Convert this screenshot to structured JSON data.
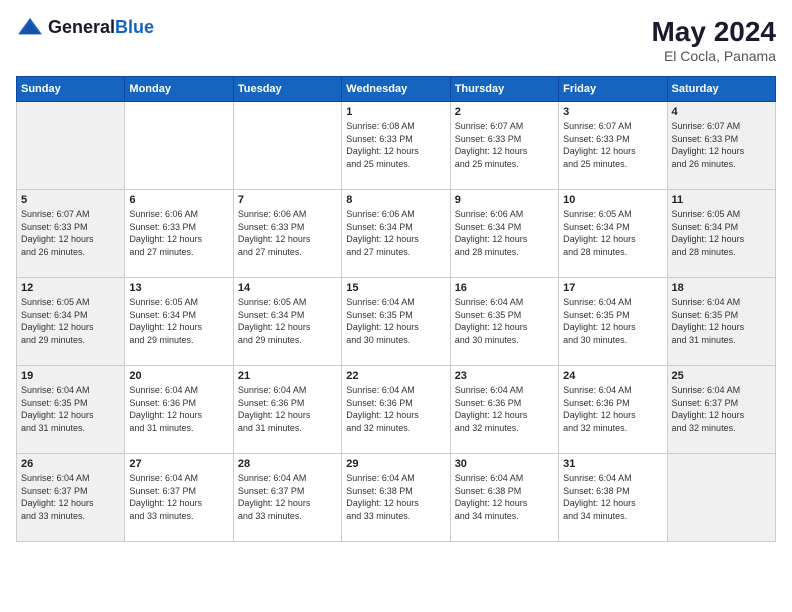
{
  "logo": {
    "general": "General",
    "blue": "Blue"
  },
  "title": {
    "month_year": "May 2024",
    "location": "El Cocla, Panama"
  },
  "headers": [
    "Sunday",
    "Monday",
    "Tuesday",
    "Wednesday",
    "Thursday",
    "Friday",
    "Saturday"
  ],
  "weeks": [
    {
      "days": [
        {
          "num": "",
          "text": "",
          "weekend": true
        },
        {
          "num": "",
          "text": "",
          "weekend": false
        },
        {
          "num": "",
          "text": "",
          "weekend": false
        },
        {
          "num": "1",
          "text": "Sunrise: 6:08 AM\nSunset: 6:33 PM\nDaylight: 12 hours\nand 25 minutes.",
          "weekend": false
        },
        {
          "num": "2",
          "text": "Sunrise: 6:07 AM\nSunset: 6:33 PM\nDaylight: 12 hours\nand 25 minutes.",
          "weekend": false
        },
        {
          "num": "3",
          "text": "Sunrise: 6:07 AM\nSunset: 6:33 PM\nDaylight: 12 hours\nand 25 minutes.",
          "weekend": false
        },
        {
          "num": "4",
          "text": "Sunrise: 6:07 AM\nSunset: 6:33 PM\nDaylight: 12 hours\nand 26 minutes.",
          "weekend": true
        }
      ]
    },
    {
      "days": [
        {
          "num": "5",
          "text": "Sunrise: 6:07 AM\nSunset: 6:33 PM\nDaylight: 12 hours\nand 26 minutes.",
          "weekend": true
        },
        {
          "num": "6",
          "text": "Sunrise: 6:06 AM\nSunset: 6:33 PM\nDaylight: 12 hours\nand 27 minutes.",
          "weekend": false
        },
        {
          "num": "7",
          "text": "Sunrise: 6:06 AM\nSunset: 6:33 PM\nDaylight: 12 hours\nand 27 minutes.",
          "weekend": false
        },
        {
          "num": "8",
          "text": "Sunrise: 6:06 AM\nSunset: 6:34 PM\nDaylight: 12 hours\nand 27 minutes.",
          "weekend": false
        },
        {
          "num": "9",
          "text": "Sunrise: 6:06 AM\nSunset: 6:34 PM\nDaylight: 12 hours\nand 28 minutes.",
          "weekend": false
        },
        {
          "num": "10",
          "text": "Sunrise: 6:05 AM\nSunset: 6:34 PM\nDaylight: 12 hours\nand 28 minutes.",
          "weekend": false
        },
        {
          "num": "11",
          "text": "Sunrise: 6:05 AM\nSunset: 6:34 PM\nDaylight: 12 hours\nand 28 minutes.",
          "weekend": true
        }
      ]
    },
    {
      "days": [
        {
          "num": "12",
          "text": "Sunrise: 6:05 AM\nSunset: 6:34 PM\nDaylight: 12 hours\nand 29 minutes.",
          "weekend": true
        },
        {
          "num": "13",
          "text": "Sunrise: 6:05 AM\nSunset: 6:34 PM\nDaylight: 12 hours\nand 29 minutes.",
          "weekend": false
        },
        {
          "num": "14",
          "text": "Sunrise: 6:05 AM\nSunset: 6:34 PM\nDaylight: 12 hours\nand 29 minutes.",
          "weekend": false
        },
        {
          "num": "15",
          "text": "Sunrise: 6:04 AM\nSunset: 6:35 PM\nDaylight: 12 hours\nand 30 minutes.",
          "weekend": false
        },
        {
          "num": "16",
          "text": "Sunrise: 6:04 AM\nSunset: 6:35 PM\nDaylight: 12 hours\nand 30 minutes.",
          "weekend": false
        },
        {
          "num": "17",
          "text": "Sunrise: 6:04 AM\nSunset: 6:35 PM\nDaylight: 12 hours\nand 30 minutes.",
          "weekend": false
        },
        {
          "num": "18",
          "text": "Sunrise: 6:04 AM\nSunset: 6:35 PM\nDaylight: 12 hours\nand 31 minutes.",
          "weekend": true
        }
      ]
    },
    {
      "days": [
        {
          "num": "19",
          "text": "Sunrise: 6:04 AM\nSunset: 6:35 PM\nDaylight: 12 hours\nand 31 minutes.",
          "weekend": true
        },
        {
          "num": "20",
          "text": "Sunrise: 6:04 AM\nSunset: 6:36 PM\nDaylight: 12 hours\nand 31 minutes.",
          "weekend": false
        },
        {
          "num": "21",
          "text": "Sunrise: 6:04 AM\nSunset: 6:36 PM\nDaylight: 12 hours\nand 31 minutes.",
          "weekend": false
        },
        {
          "num": "22",
          "text": "Sunrise: 6:04 AM\nSunset: 6:36 PM\nDaylight: 12 hours\nand 32 minutes.",
          "weekend": false
        },
        {
          "num": "23",
          "text": "Sunrise: 6:04 AM\nSunset: 6:36 PM\nDaylight: 12 hours\nand 32 minutes.",
          "weekend": false
        },
        {
          "num": "24",
          "text": "Sunrise: 6:04 AM\nSunset: 6:36 PM\nDaylight: 12 hours\nand 32 minutes.",
          "weekend": false
        },
        {
          "num": "25",
          "text": "Sunrise: 6:04 AM\nSunset: 6:37 PM\nDaylight: 12 hours\nand 32 minutes.",
          "weekend": true
        }
      ]
    },
    {
      "days": [
        {
          "num": "26",
          "text": "Sunrise: 6:04 AM\nSunset: 6:37 PM\nDaylight: 12 hours\nand 33 minutes.",
          "weekend": true
        },
        {
          "num": "27",
          "text": "Sunrise: 6:04 AM\nSunset: 6:37 PM\nDaylight: 12 hours\nand 33 minutes.",
          "weekend": false
        },
        {
          "num": "28",
          "text": "Sunrise: 6:04 AM\nSunset: 6:37 PM\nDaylight: 12 hours\nand 33 minutes.",
          "weekend": false
        },
        {
          "num": "29",
          "text": "Sunrise: 6:04 AM\nSunset: 6:38 PM\nDaylight: 12 hours\nand 33 minutes.",
          "weekend": false
        },
        {
          "num": "30",
          "text": "Sunrise: 6:04 AM\nSunset: 6:38 PM\nDaylight: 12 hours\nand 34 minutes.",
          "weekend": false
        },
        {
          "num": "31",
          "text": "Sunrise: 6:04 AM\nSunset: 6:38 PM\nDaylight: 12 hours\nand 34 minutes.",
          "weekend": false
        },
        {
          "num": "",
          "text": "",
          "weekend": true
        }
      ]
    }
  ]
}
